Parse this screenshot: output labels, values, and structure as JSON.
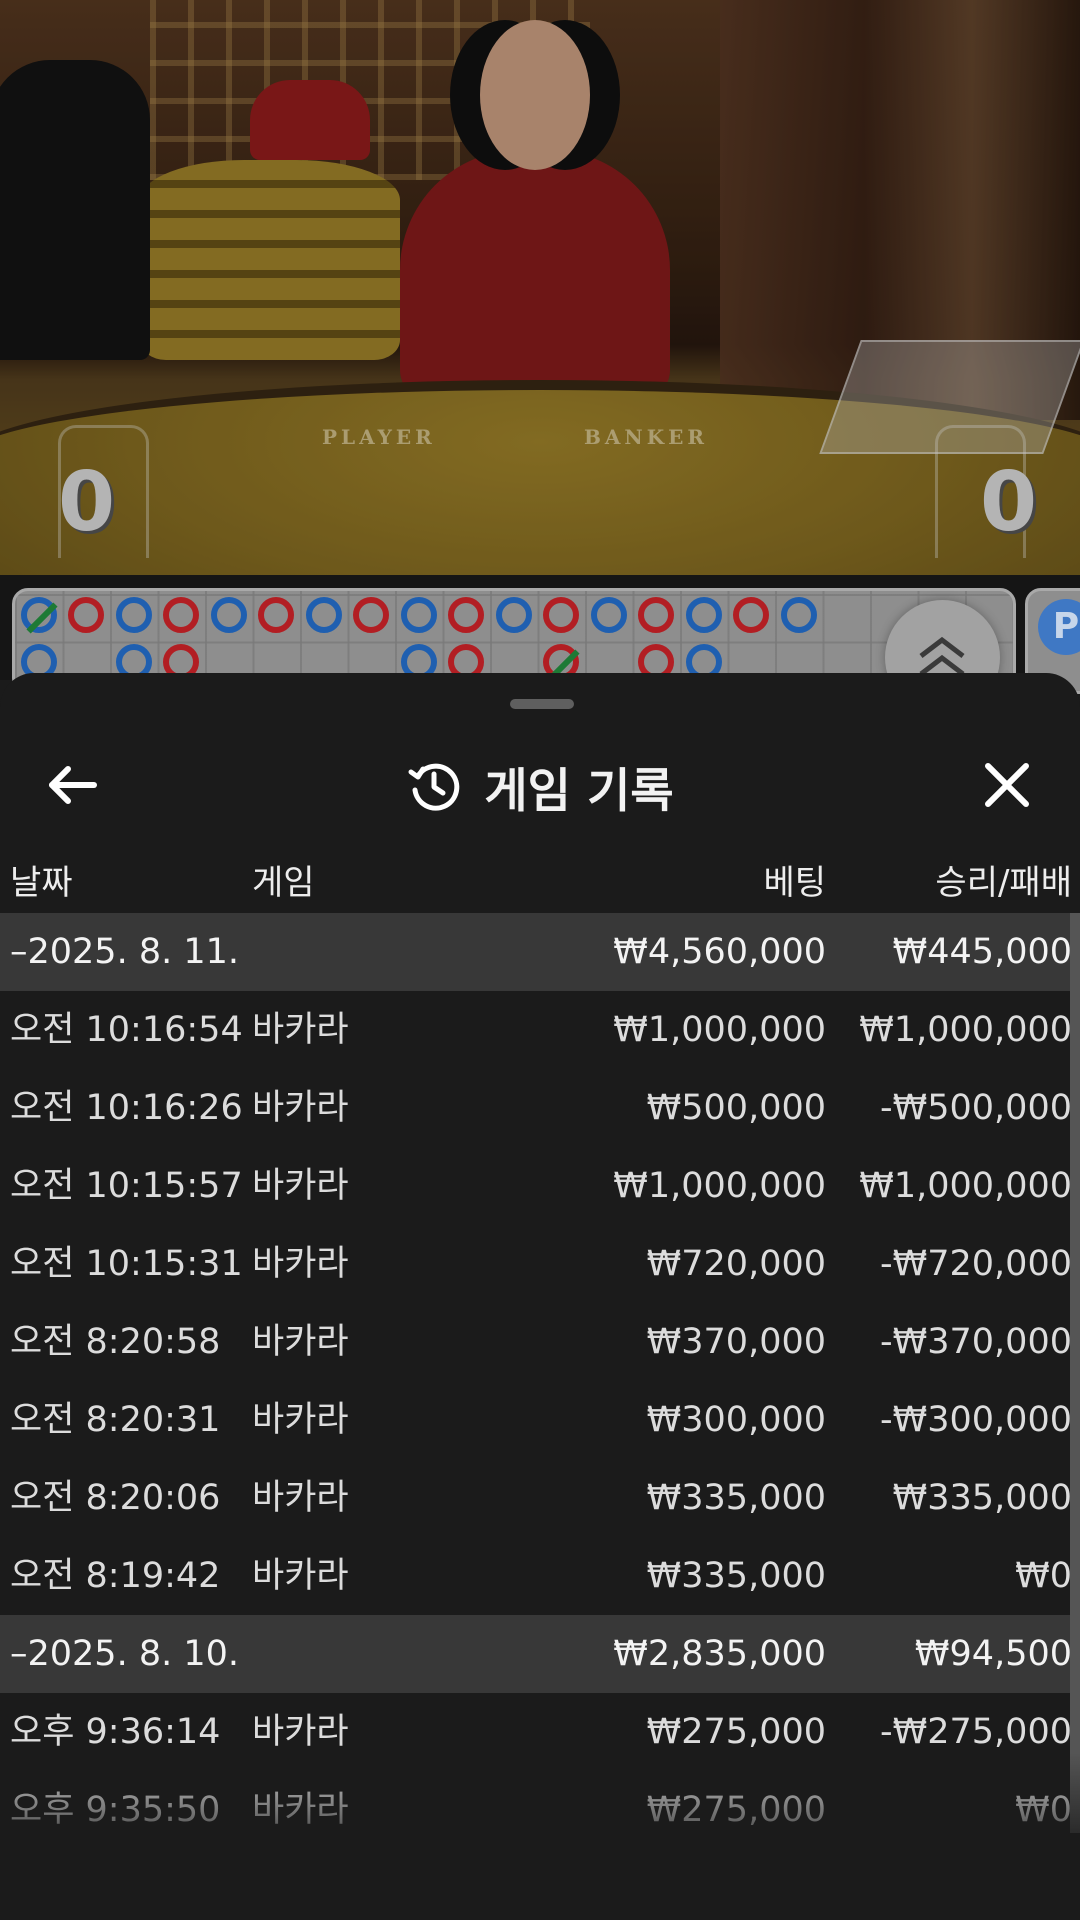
{
  "video": {
    "felt_labels": {
      "player": "PLAYER",
      "banker": "BANKER"
    },
    "player_score": "0",
    "banker_score": "0"
  },
  "roadmap": {
    "colors": {
      "player": "#1f5fb0",
      "banker": "#b21e23",
      "tie": "#1e7a35"
    },
    "side_badge": "P"
  },
  "sheet": {
    "title": "게임 기록",
    "icons": {
      "back": "arrow-left-icon",
      "history": "history-icon",
      "close": "close-icon",
      "expand": "chevron-double-up-icon"
    },
    "columns": {
      "date": "날짜",
      "game": "게임",
      "bet": "베팅",
      "result": "승리/패배"
    },
    "groups": [
      {
        "date": "–2025. 8. 11.",
        "bet_total": "₩4,560,000",
        "result_total": "₩445,000",
        "rows": [
          {
            "time": "오전 10:16:54",
            "game": "바카라",
            "bet": "₩1,000,000",
            "result": "₩1,000,000"
          },
          {
            "time": "오전 10:16:26",
            "game": "바카라",
            "bet": "₩500,000",
            "result": "-₩500,000"
          },
          {
            "time": "오전 10:15:57",
            "game": "바카라",
            "bet": "₩1,000,000",
            "result": "₩1,000,000"
          },
          {
            "time": "오전 10:15:31",
            "game": "바카라",
            "bet": "₩720,000",
            "result": "-₩720,000"
          },
          {
            "time": "오전 8:20:58",
            "game": "바카라",
            "bet": "₩370,000",
            "result": "-₩370,000"
          },
          {
            "time": "오전 8:20:31",
            "game": "바카라",
            "bet": "₩300,000",
            "result": "-₩300,000"
          },
          {
            "time": "오전 8:20:06",
            "game": "바카라",
            "bet": "₩335,000",
            "result": "₩335,000"
          },
          {
            "time": "오전 8:19:42",
            "game": "바카라",
            "bet": "₩335,000",
            "result": "₩0"
          }
        ]
      },
      {
        "date": "–2025. 8. 10.",
        "bet_total": "₩2,835,000",
        "result_total": "₩94,500",
        "rows": [
          {
            "time": "오후 9:36:14",
            "game": "바카라",
            "bet": "₩275,000",
            "result": "-₩275,000"
          },
          {
            "time": "오후 9:35:50",
            "game": "바카라",
            "bet": "₩275,000",
            "result": "₩0"
          }
        ]
      }
    ]
  }
}
